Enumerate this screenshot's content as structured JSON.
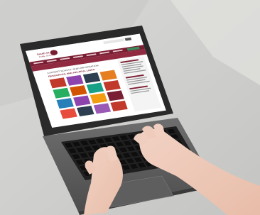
{
  "photo": {
    "description_free": true
  },
  "site": {
    "logo_line1": "South St. Paul",
    "logo_line2": "Public Schools",
    "page_heading": "CURRENT SCHOOL YEAR INFORMATION",
    "section_heading": "RESOURCES AND HELPFUL LINKS"
  },
  "colors": {
    "brand_maroon": "#7a1f33",
    "page_bg": "#ffffff",
    "tile_colors": [
      "#c0392b",
      "#8e44ad",
      "#2c3e50",
      "#e67e22",
      "#27ae60",
      "#d35400",
      "#16a085",
      "#c0392b",
      "#2980b9",
      "#8e44ad",
      "#f39c12",
      "#7a1f33",
      "#e74c3c",
      "#2c3e50",
      "#9b59b6",
      "#c0392b"
    ]
  }
}
